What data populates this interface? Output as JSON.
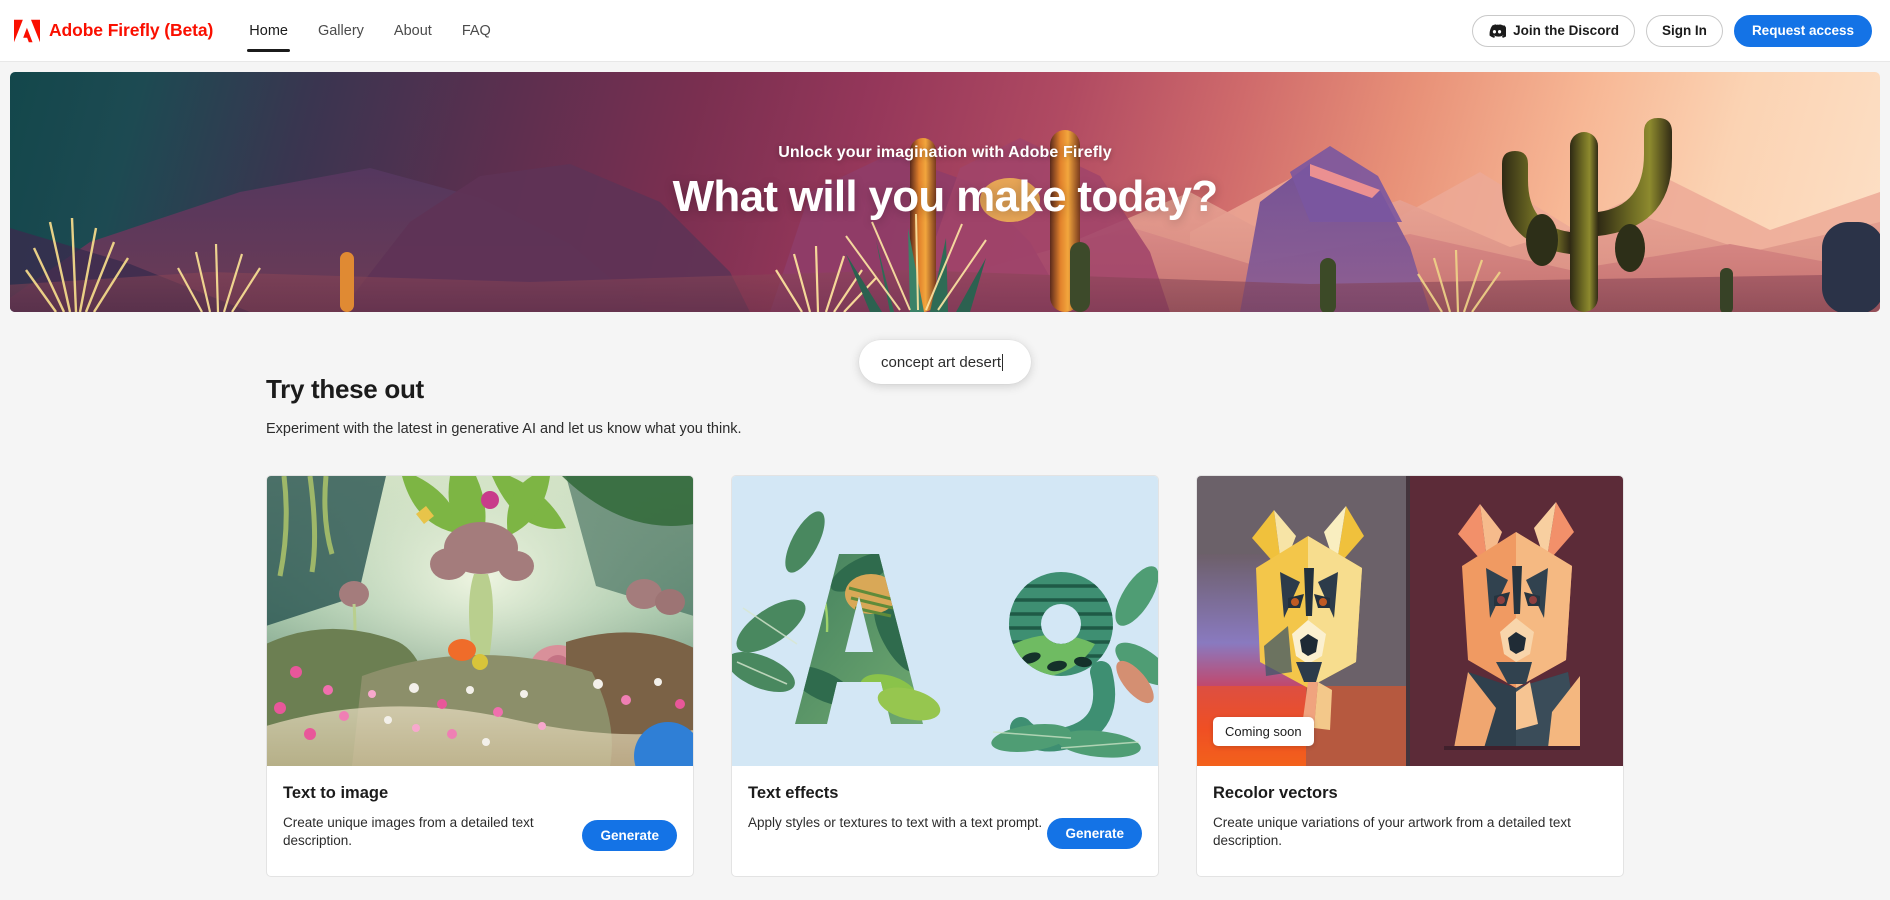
{
  "header": {
    "brand_name": "Adobe Firefly (Beta)",
    "logo_icon": "adobe-a-icon",
    "brand_color": "#FA0F00",
    "nav": [
      {
        "label": "Home",
        "active": true
      },
      {
        "label": "Gallery",
        "active": false
      },
      {
        "label": "About",
        "active": false
      },
      {
        "label": "FAQ",
        "active": false
      }
    ],
    "actions": {
      "discord_icon": "discord-icon",
      "discord_label": "Join the Discord",
      "signin_label": "Sign In",
      "request_label": "Request access",
      "primary_color": "#1473E6"
    }
  },
  "hero": {
    "kicker": "Unlock your imagination with Adobe Firefly",
    "title": "What will you make today?",
    "scene": "desert cactus sunset landscape"
  },
  "prompt": {
    "value": "concept art desert",
    "placeholder": "concept art desert"
  },
  "try_section": {
    "title": "Try these out",
    "subtitle": "Experiment with the latest in generative AI and let us know what you think."
  },
  "cards": [
    {
      "title": "Text to image",
      "description": "Create unique images from a detailed text description.",
      "button_label": "Generate",
      "has_button": true,
      "badge": null,
      "art": "fantasy-garden-flowers"
    },
    {
      "title": "Text effects",
      "description": "Apply styles or textures to text with a text prompt.",
      "button_label": "Generate",
      "has_button": true,
      "badge": null,
      "art": "leafy-letters-Ag"
    },
    {
      "title": "Recolor vectors",
      "description": "Create unique variations of your artwork from a detailed text description.",
      "button_label": null,
      "has_button": false,
      "badge": "Coming soon",
      "art": "low-poly-dog-pair"
    }
  ]
}
